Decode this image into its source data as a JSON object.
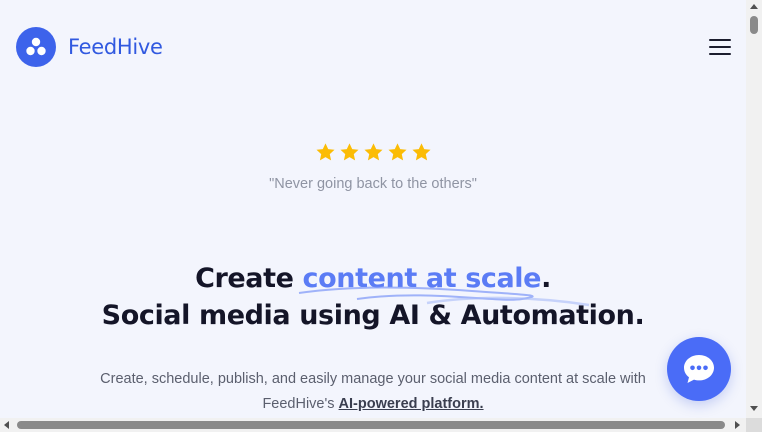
{
  "header": {
    "brand": "FeedHive",
    "logo_icon": "hexagon-cluster-logo",
    "menu_icon": "hamburger-menu-icon"
  },
  "rating": {
    "stars": 5,
    "star_color": "#fbbc05",
    "quote": "\"Never going back to the others\""
  },
  "hero": {
    "line1_prefix": "Create ",
    "line1_highlight": "content at scale",
    "line1_suffix": ".",
    "line2": "Social media using AI & Automation.",
    "subtext_before": "Create, schedule, publish, and easily manage your social media content at scale with FeedHive's ",
    "subtext_link": "AI-powered platform.",
    "highlight_color": "#5b7cf5"
  },
  "chat": {
    "icon": "chat-bubble-icon",
    "color": "#4a6cf7"
  },
  "colors": {
    "brand": "#3d63eb",
    "background": "#f3f5fd",
    "text": "#141528"
  }
}
